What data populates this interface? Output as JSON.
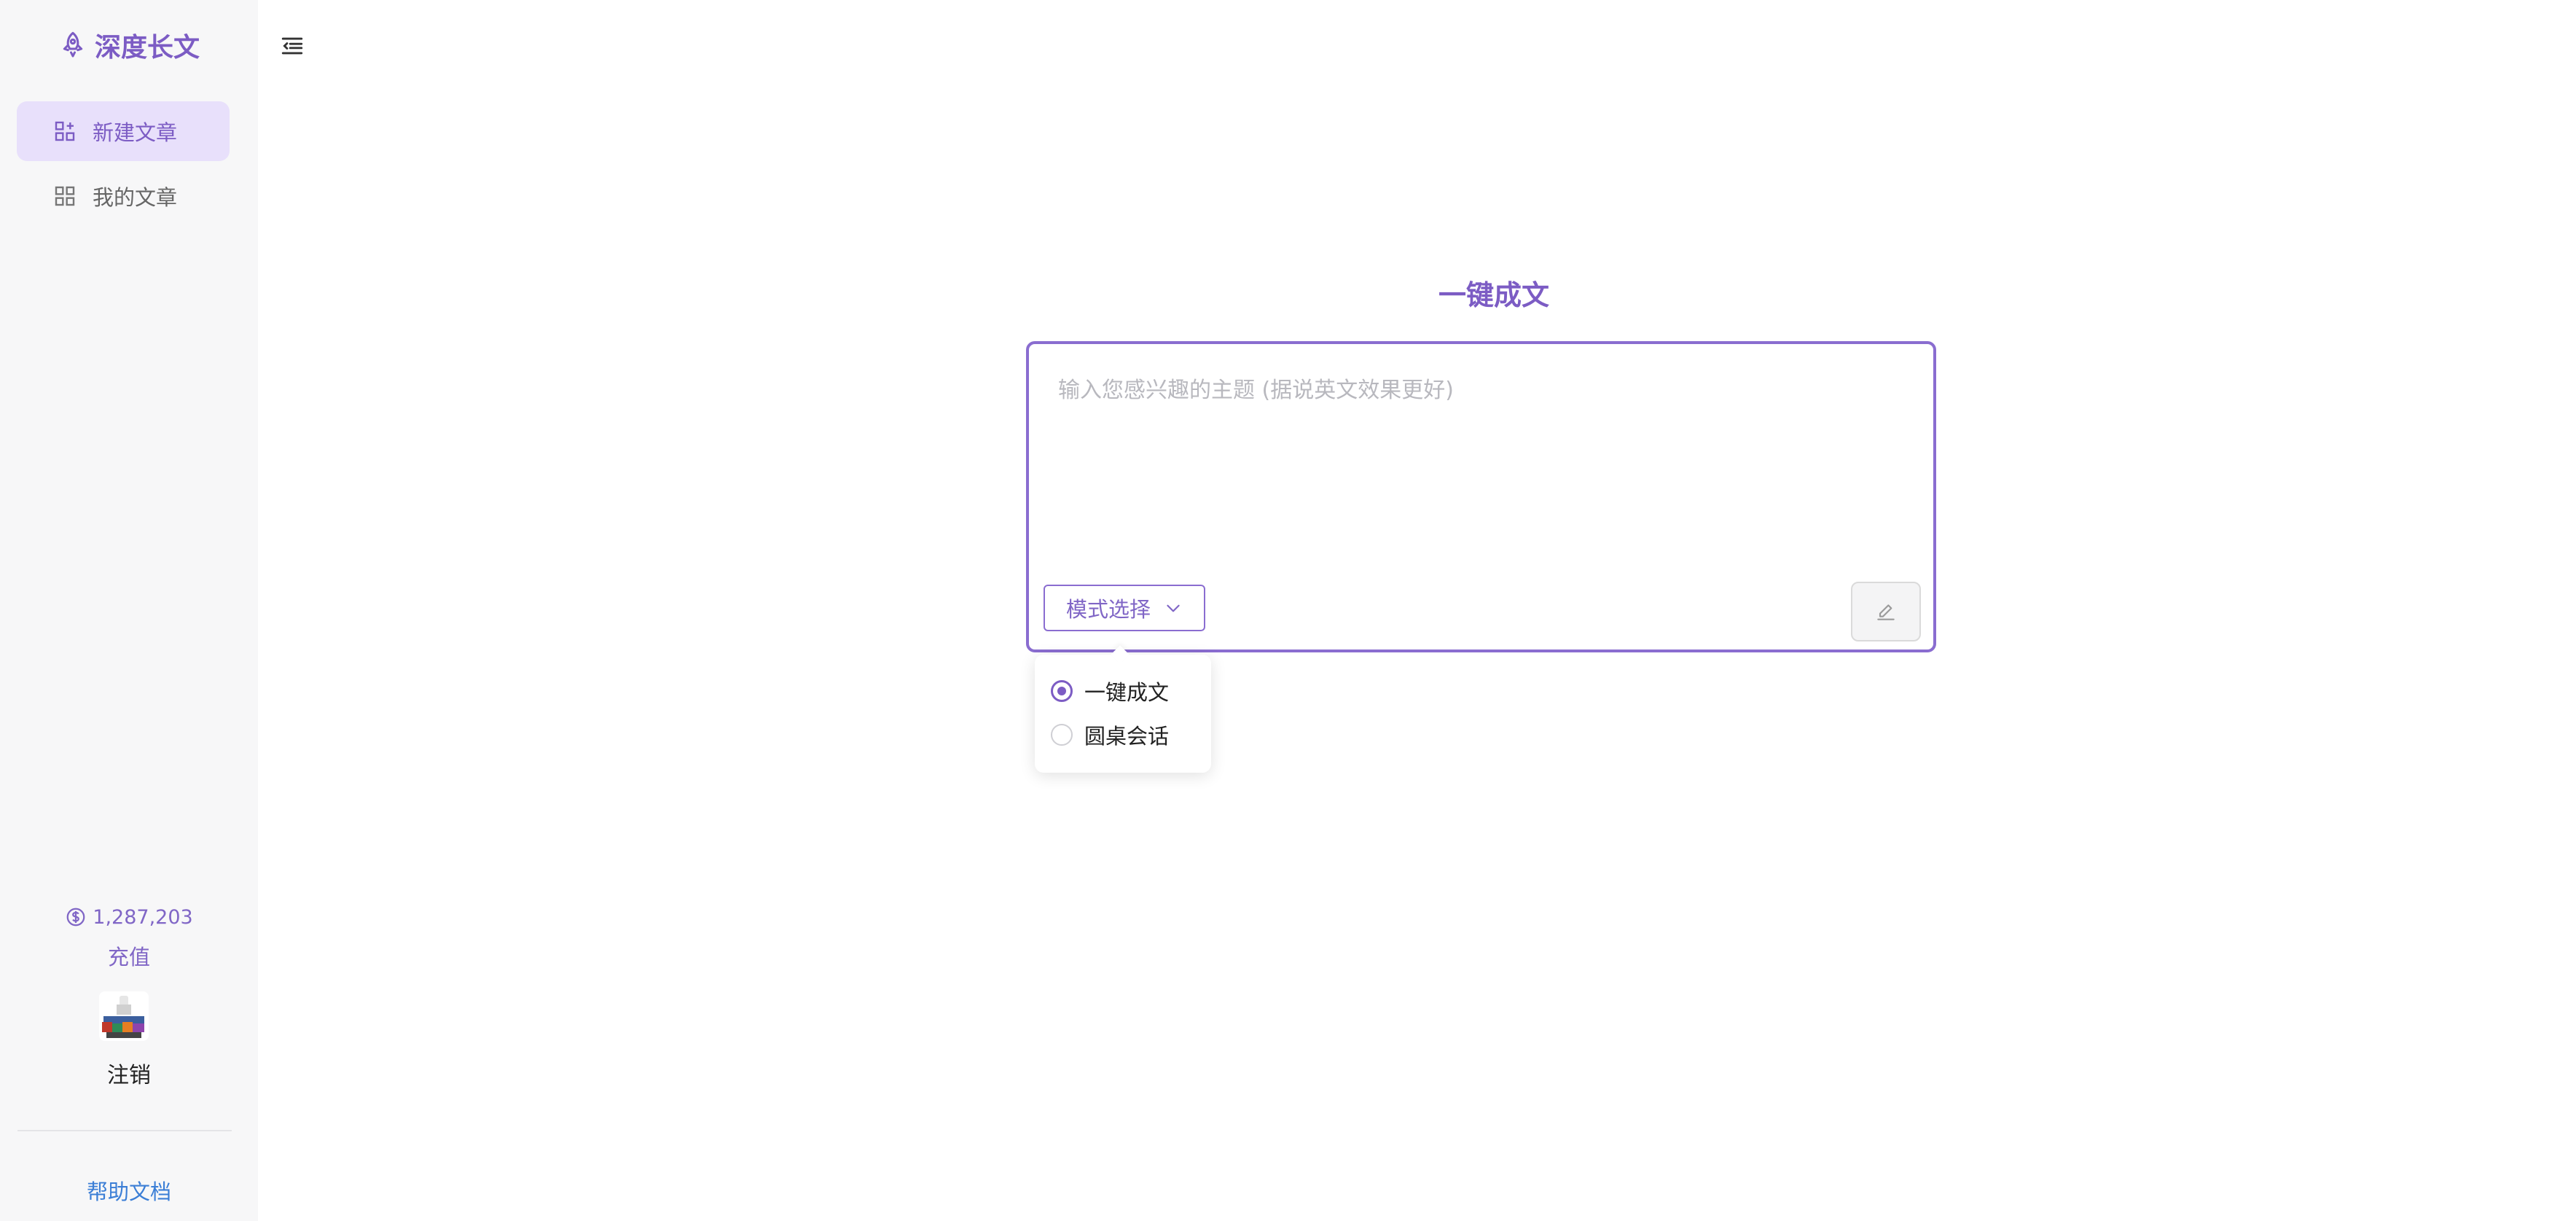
{
  "sidebar": {
    "brand": "深度长文",
    "nav": [
      {
        "label": "新建文章",
        "icon": "new-article-icon",
        "active": true
      },
      {
        "label": "我的文章",
        "icon": "my-articles-icon",
        "active": false
      }
    ],
    "balance": "1,287,203",
    "recharge_label": "充值",
    "logout_label": "注销",
    "help_label": "帮助文档"
  },
  "main": {
    "title": "一键成文",
    "input_placeholder": "输入您感兴趣的主题 (据说英文效果更好)",
    "input_value": "",
    "mode_select_label": "模式选择"
  },
  "dropdown": {
    "options": [
      {
        "label": "一键成文",
        "selected": true
      },
      {
        "label": "圆桌会话",
        "selected": false
      }
    ]
  },
  "colors": {
    "accent": "#7c5cc4",
    "active_nav_bg": "#e8e0fb",
    "sidebar_bg": "#f7f7f8",
    "help_link": "#3b7ed6"
  }
}
